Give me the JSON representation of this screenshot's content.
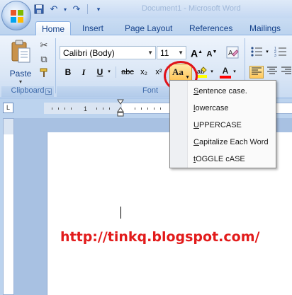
{
  "title_bar": {
    "title_text": "Document1 - Microsoft Word"
  },
  "tabs": [
    {
      "label": "Home",
      "active": true
    },
    {
      "label": "Insert",
      "active": false
    },
    {
      "label": "Page Layout",
      "active": false
    },
    {
      "label": "References",
      "active": false
    },
    {
      "label": "Mailings",
      "active": false
    }
  ],
  "clipboard": {
    "paste_label": "Paste",
    "group_label": "Clipboard"
  },
  "font": {
    "font_name": "Calibri (Body)",
    "font_size": "11",
    "group_label": "Font",
    "bold": "B",
    "italic": "I",
    "underline": "U",
    "strikethrough": "abc",
    "subscript": "x₂",
    "superscript": "x²",
    "change_case": "Aa",
    "grow_font": "A",
    "shrink_font": "A",
    "font_color": "A"
  },
  "change_case_menu": [
    {
      "underlined": "S",
      "rest": "entence case."
    },
    {
      "underlined": "l",
      "rest": "owercase"
    },
    {
      "underlined": "U",
      "rest": "PPERCASE"
    },
    {
      "underlined": "C",
      "rest": "apitalize Each Word"
    },
    {
      "underlined": "t",
      "rest": "OGGLE cASE"
    }
  ],
  "ruler": {
    "label_1": "1",
    "label_2": "1",
    "tab_selector": "L"
  },
  "document": {
    "watermark_text": "http://tinkq.blogspot.com/"
  },
  "colors": {
    "accent": "#15428b",
    "highlight_circle": "#e0131b",
    "watermark": "#e21b1b"
  }
}
